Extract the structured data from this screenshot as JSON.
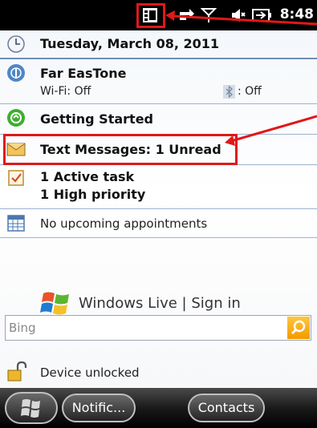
{
  "status": {
    "time": "8:48",
    "icons": [
      "phone-status-icon",
      "data-arrows-icon",
      "signal-icon",
      "volume-icon",
      "battery-icon"
    ]
  },
  "today": {
    "date": "Tuesday, March 08, 2011",
    "carrier": "Far EasTone",
    "wifi": "Wi-Fi: Off",
    "bluetooth": ": Off",
    "getting_started": "Getting Started",
    "messages": "Text Messages: 1 Unread",
    "tasks_line1": "1 Active task",
    "tasks_line2": "1 High priority",
    "appointments": "No upcoming appointments",
    "windows_live": "Windows Live | Sign in",
    "lock": "Device unlocked"
  },
  "search": {
    "placeholder": "Bing"
  },
  "bottombar": {
    "left": "Notific...",
    "right": "Contacts"
  },
  "colors": {
    "highlight": "#e01818",
    "accent": "#f39a00"
  }
}
